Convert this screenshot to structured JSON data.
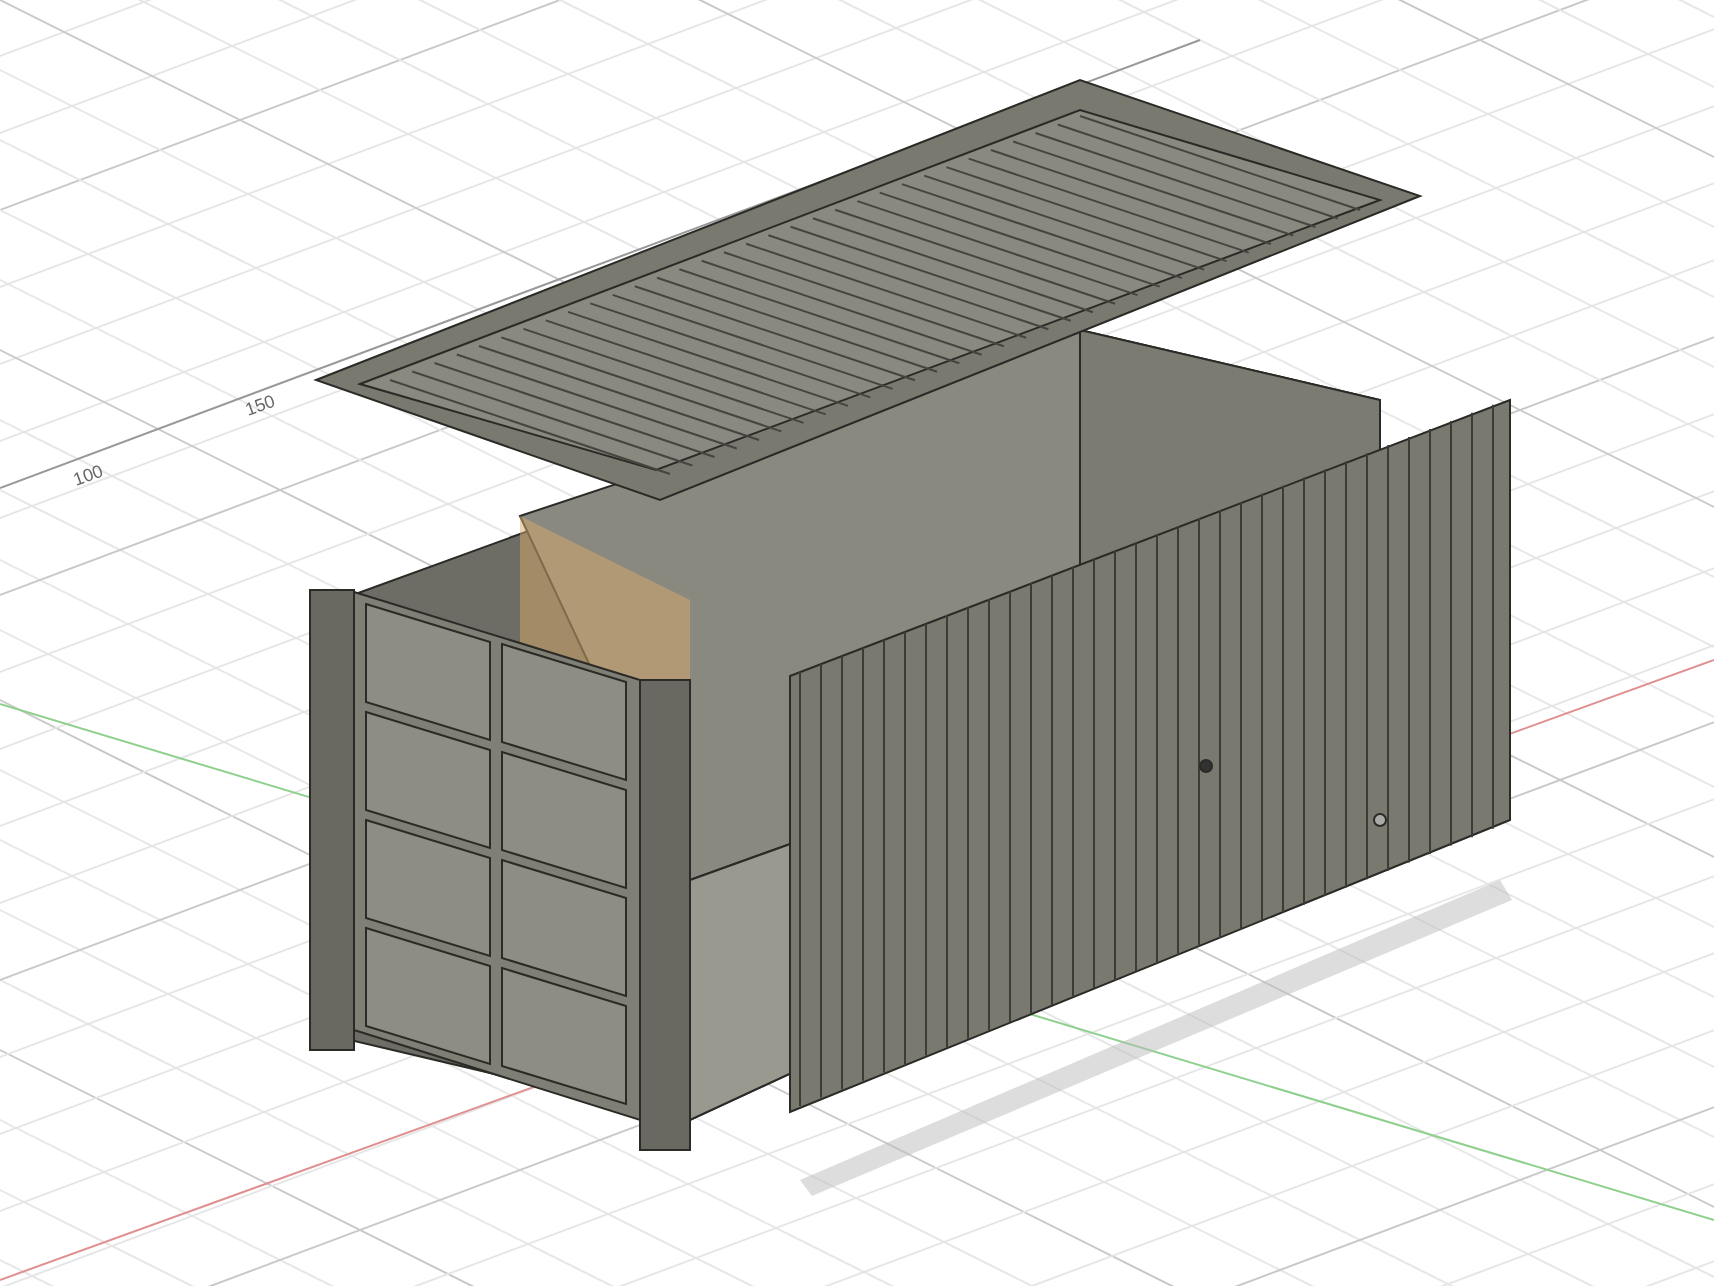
{
  "viewport": {
    "grid_labels": [
      {
        "text": "150"
      },
      {
        "text": "100"
      }
    ]
  }
}
